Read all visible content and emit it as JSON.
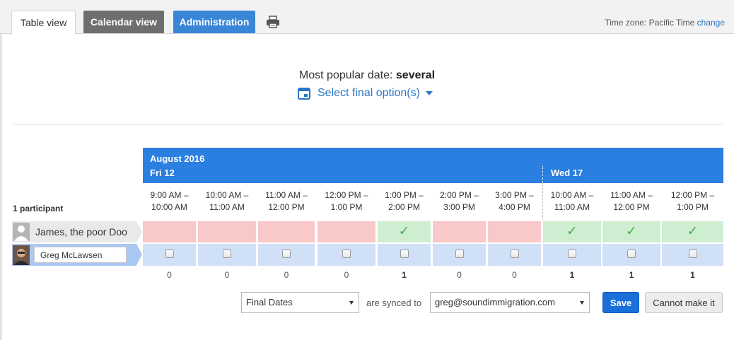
{
  "tabs": {
    "table_view": "Table view",
    "calendar_view": "Calendar view",
    "administration": "Administration"
  },
  "timezone": {
    "label": "Time zone: Pacific Time",
    "change": "change"
  },
  "summary": {
    "popular_label": "Most popular date:",
    "popular_value": "several",
    "select_final": "Select final option(s)"
  },
  "grid": {
    "month": "August 2016",
    "days": [
      "Fri 12",
      "Wed 17"
    ],
    "times": [
      [
        "9:00 AM –",
        "10:00 AM"
      ],
      [
        "10:00 AM –",
        "11:00 AM"
      ],
      [
        "11:00 AM –",
        "12:00 PM"
      ],
      [
        "12:00 PM –",
        "1:00 PM"
      ],
      [
        "1:00 PM –",
        "2:00 PM"
      ],
      [
        "2:00 PM –",
        "3:00 PM"
      ],
      [
        "3:00 PM –",
        "4:00 PM"
      ],
      [
        "10:00 AM –",
        "11:00 AM"
      ],
      [
        "11:00 AM –",
        "12:00 PM"
      ],
      [
        "12:00 PM –",
        "1:00 PM"
      ]
    ],
    "participants_count": "1 participant",
    "participants": [
      {
        "name": "James, the poor Doo",
        "votes": [
          "no",
          "no",
          "no",
          "no",
          "yes",
          "no",
          "no",
          "yes",
          "yes",
          "yes"
        ]
      }
    ],
    "current_user": {
      "name": "Greg McLawsen"
    },
    "counts": [
      "0",
      "0",
      "0",
      "0",
      "1",
      "0",
      "0",
      "1",
      "1",
      "1"
    ]
  },
  "footer": {
    "calendar_select": "Final Dates",
    "synced_label": "are synced to",
    "email_select": "greg@soundimmigration.com",
    "save": "Save",
    "cannot": "Cannot make it"
  },
  "colors": {
    "accent": "#2a7fe0",
    "no": "#f9c8c8",
    "yes": "#cfeed1",
    "check": "#4caf50"
  }
}
